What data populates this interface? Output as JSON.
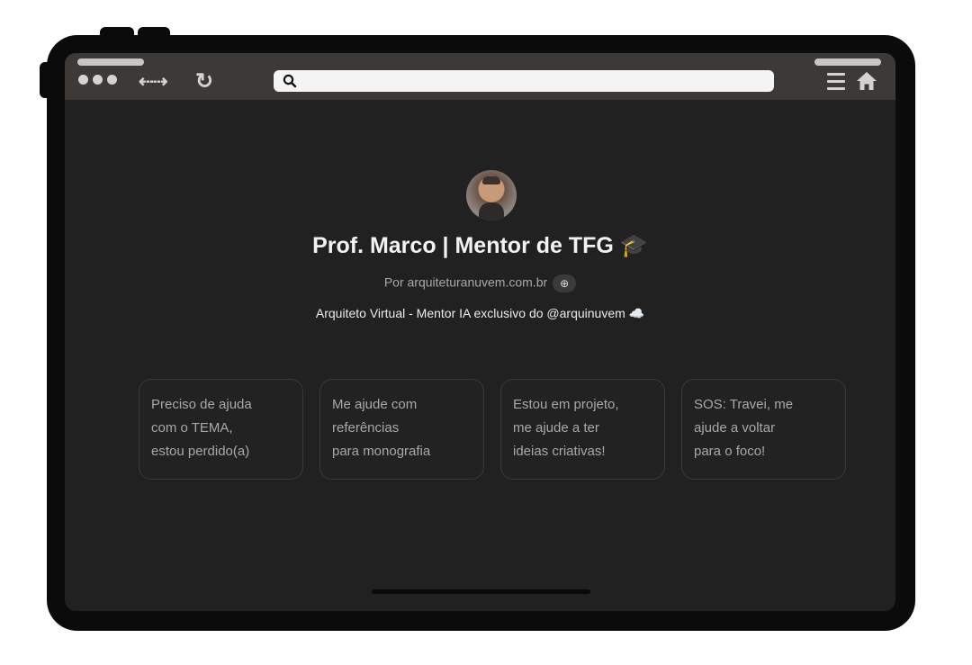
{
  "browser": {
    "icons": [
      "window-dots",
      "back-arrow",
      "forward-arrow",
      "reload",
      "search",
      "menu",
      "home"
    ],
    "address_value": ""
  },
  "profile": {
    "title": "Prof. Marco | Mentor de TFG 🎓",
    "byline": "Por arquiteturanuvem.com.br",
    "description": "Arquiteto Virtual - Mentor IA exclusivo do @arquinuvem ☁️"
  },
  "suggestions": [
    {
      "text": "Preciso de ajuda\ncom o TEMA,\nestou perdido(a)"
    },
    {
      "text": "Me ajude com\nreferências\npara monografia"
    },
    {
      "text": "Estou em projeto,\nme ajude a ter\nideias criativas!"
    },
    {
      "text": "SOS: Travei, me\najude a voltar\npara o foco!"
    }
  ],
  "colors": {
    "frame": "#0b0b0b",
    "screen": "#212121",
    "browser_bar": "#3d3937",
    "card_border": "#3a3a3a"
  }
}
